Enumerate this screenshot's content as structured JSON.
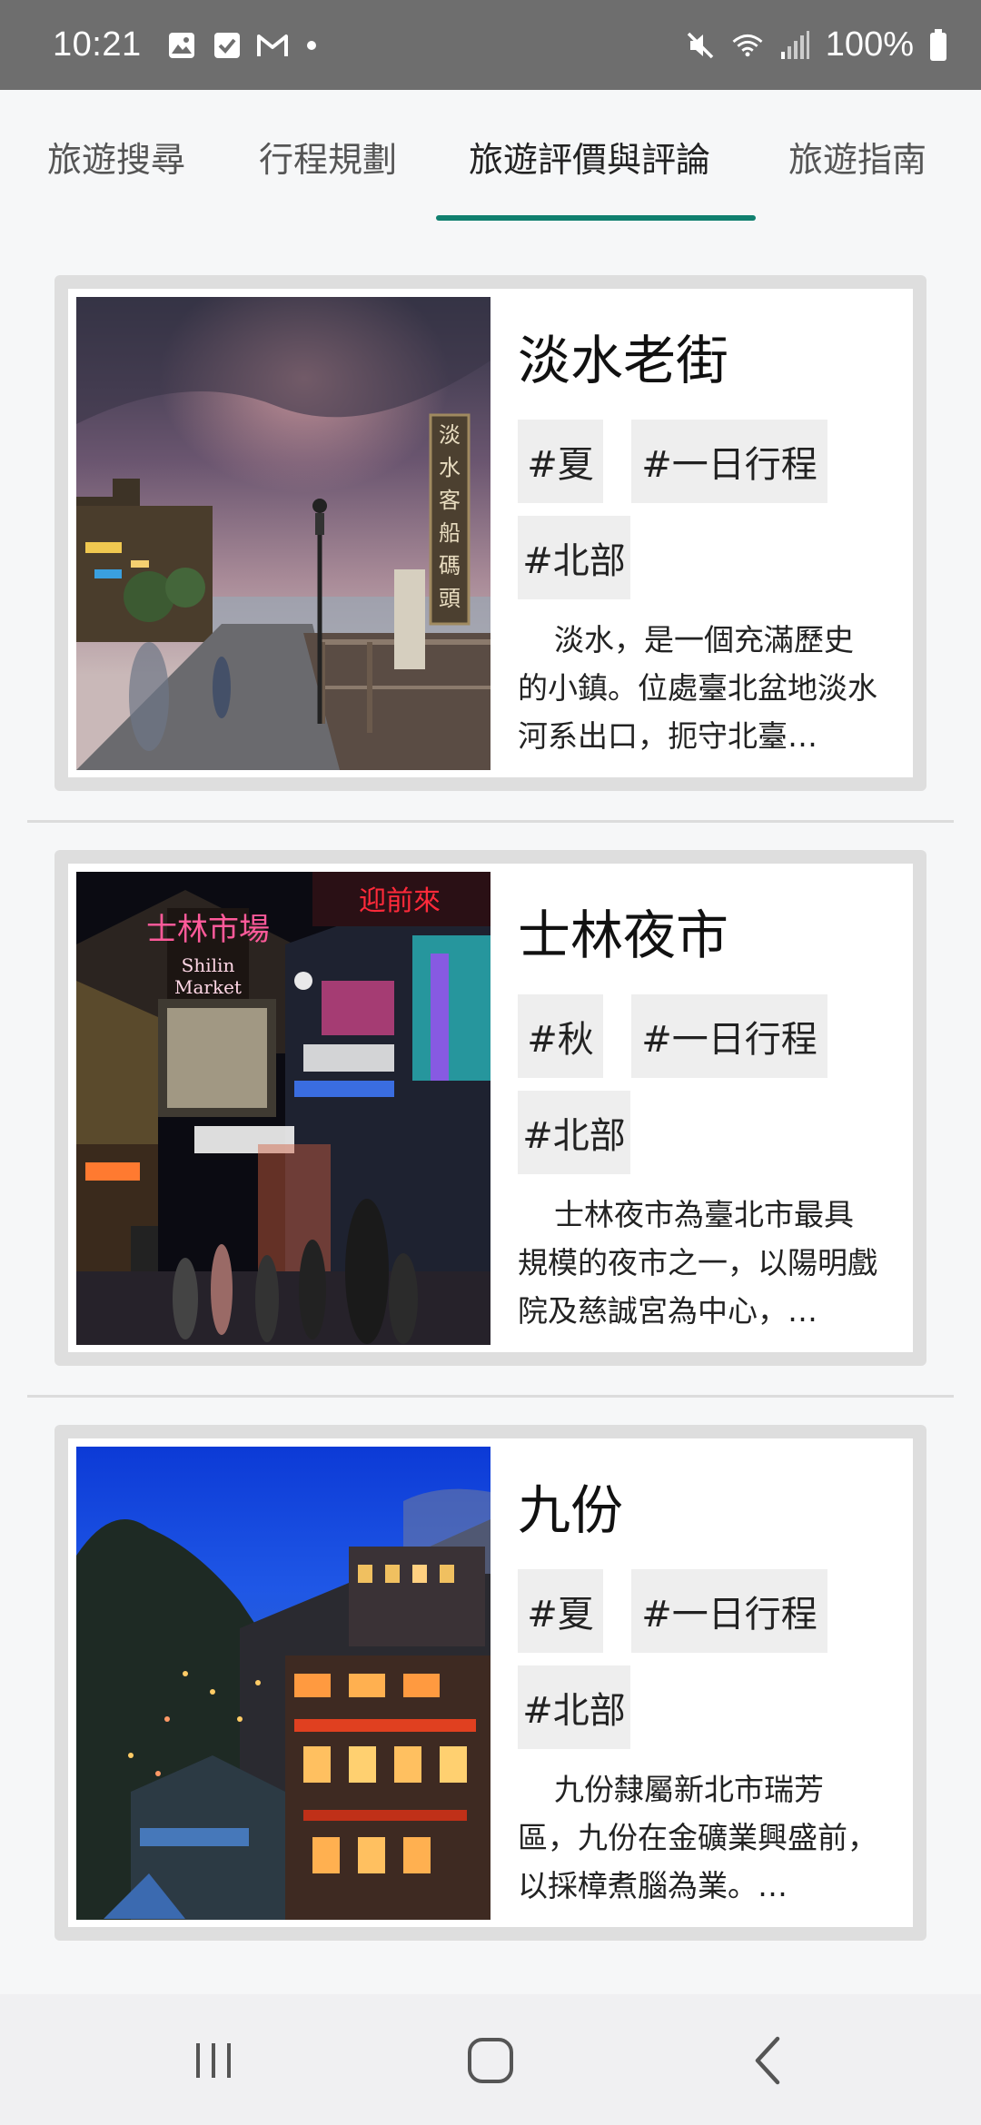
{
  "status_bar": {
    "time": "10:21",
    "left_icons": [
      "image-icon",
      "check-square-icon",
      "gmail-icon"
    ],
    "right_icons": [
      "mute-icon",
      "wifi-icon",
      "signal-icon"
    ],
    "battery": "100%"
  },
  "tabs": [
    {
      "label": "旅遊搜尋",
      "active": false
    },
    {
      "label": "行程規劃",
      "active": false
    },
    {
      "label": "旅遊評價與評論",
      "active": true
    },
    {
      "label": "旅遊指南",
      "active": false
    }
  ],
  "accent_color": "#10806f",
  "cards": [
    {
      "title": "淡水老街",
      "tags": [
        "#夏",
        "#一日行程",
        "#北部"
      ],
      "description": "淡水，是一個充滿歷史的小鎮。位處臺北盆地淡水河系出口，扼守北臺…",
      "photo": "tamsui-old-street-photo",
      "sign_text": "淡水客船碼頭"
    },
    {
      "title": "士林夜市",
      "tags": [
        "#秋",
        "#一日行程",
        "#北部"
      ],
      "description": "士林夜市為臺北市最具規模的夜市之一，以陽明戲院及慈誠宮為中心，…",
      "photo": "shilin-night-market-photo",
      "sign_text": "士林市場",
      "sign_subtext": "Shilin Market"
    },
    {
      "title": "九份",
      "tags": [
        "#夏",
        "#一日行程",
        "#北部"
      ],
      "description": "九份隸屬新北市瑞芳區，九份在金礦業興盛前，以採樟煮腦為業。…",
      "photo": "jiufen-photo"
    }
  ],
  "nav_bar": [
    "recent-apps-icon",
    "home-icon",
    "back-icon"
  ]
}
